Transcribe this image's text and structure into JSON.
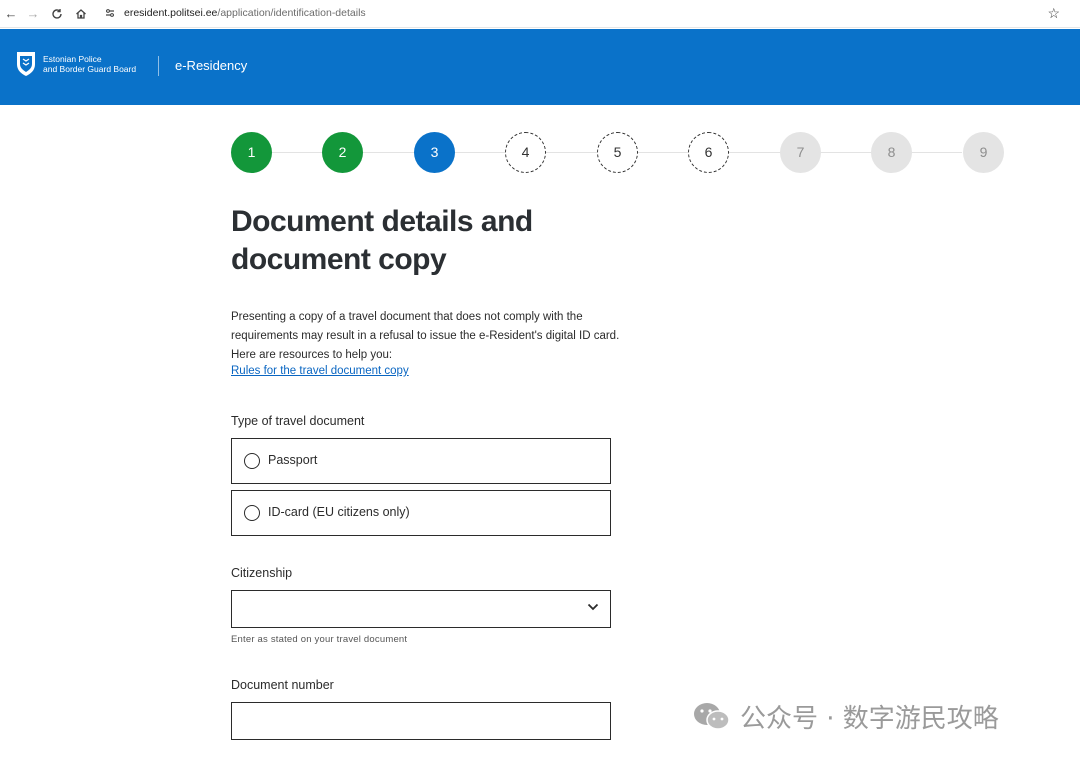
{
  "browser": {
    "url_domain": "eresident.politsei.ee",
    "url_path": "/application/identification-details"
  },
  "header": {
    "org_line1": "Estonian Police",
    "org_line2": "and Border Guard Board",
    "brand": "e-Residency"
  },
  "stepper": {
    "steps": [
      {
        "label": "1",
        "state": "done"
      },
      {
        "label": "2",
        "state": "done"
      },
      {
        "label": "3",
        "state": "current"
      },
      {
        "label": "4",
        "state": "todo"
      },
      {
        "label": "5",
        "state": "todo"
      },
      {
        "label": "6",
        "state": "todo"
      },
      {
        "label": "7",
        "state": "locked"
      },
      {
        "label": "8",
        "state": "locked"
      },
      {
        "label": "9",
        "state": "locked"
      }
    ]
  },
  "page": {
    "title_line1": "Document details and",
    "title_line2": "document copy",
    "intro_line1": "Presenting a copy of a travel document that does not comply with the",
    "intro_line2": "requirements may result in a refusal to issue the e-Resident's digital ID card.",
    "intro_line3": "Here are resources to help you:",
    "rules_link": "Rules for the travel document copy"
  },
  "form": {
    "doc_type_label": "Type of travel document",
    "options": [
      "Passport",
      "ID-card (EU citizens only)"
    ],
    "citizenship_label": "Citizenship",
    "citizenship_value": "",
    "citizenship_hint": "Enter as stated on your travel document",
    "doc_number_label": "Document number",
    "doc_number_value": ""
  },
  "watermark": {
    "text": "公众号 · 数字游民攻略"
  },
  "colors": {
    "header_blue": "#0a72c9",
    "step_done": "#13973a",
    "step_current": "#0a72c9",
    "link": "#0a66c2"
  }
}
